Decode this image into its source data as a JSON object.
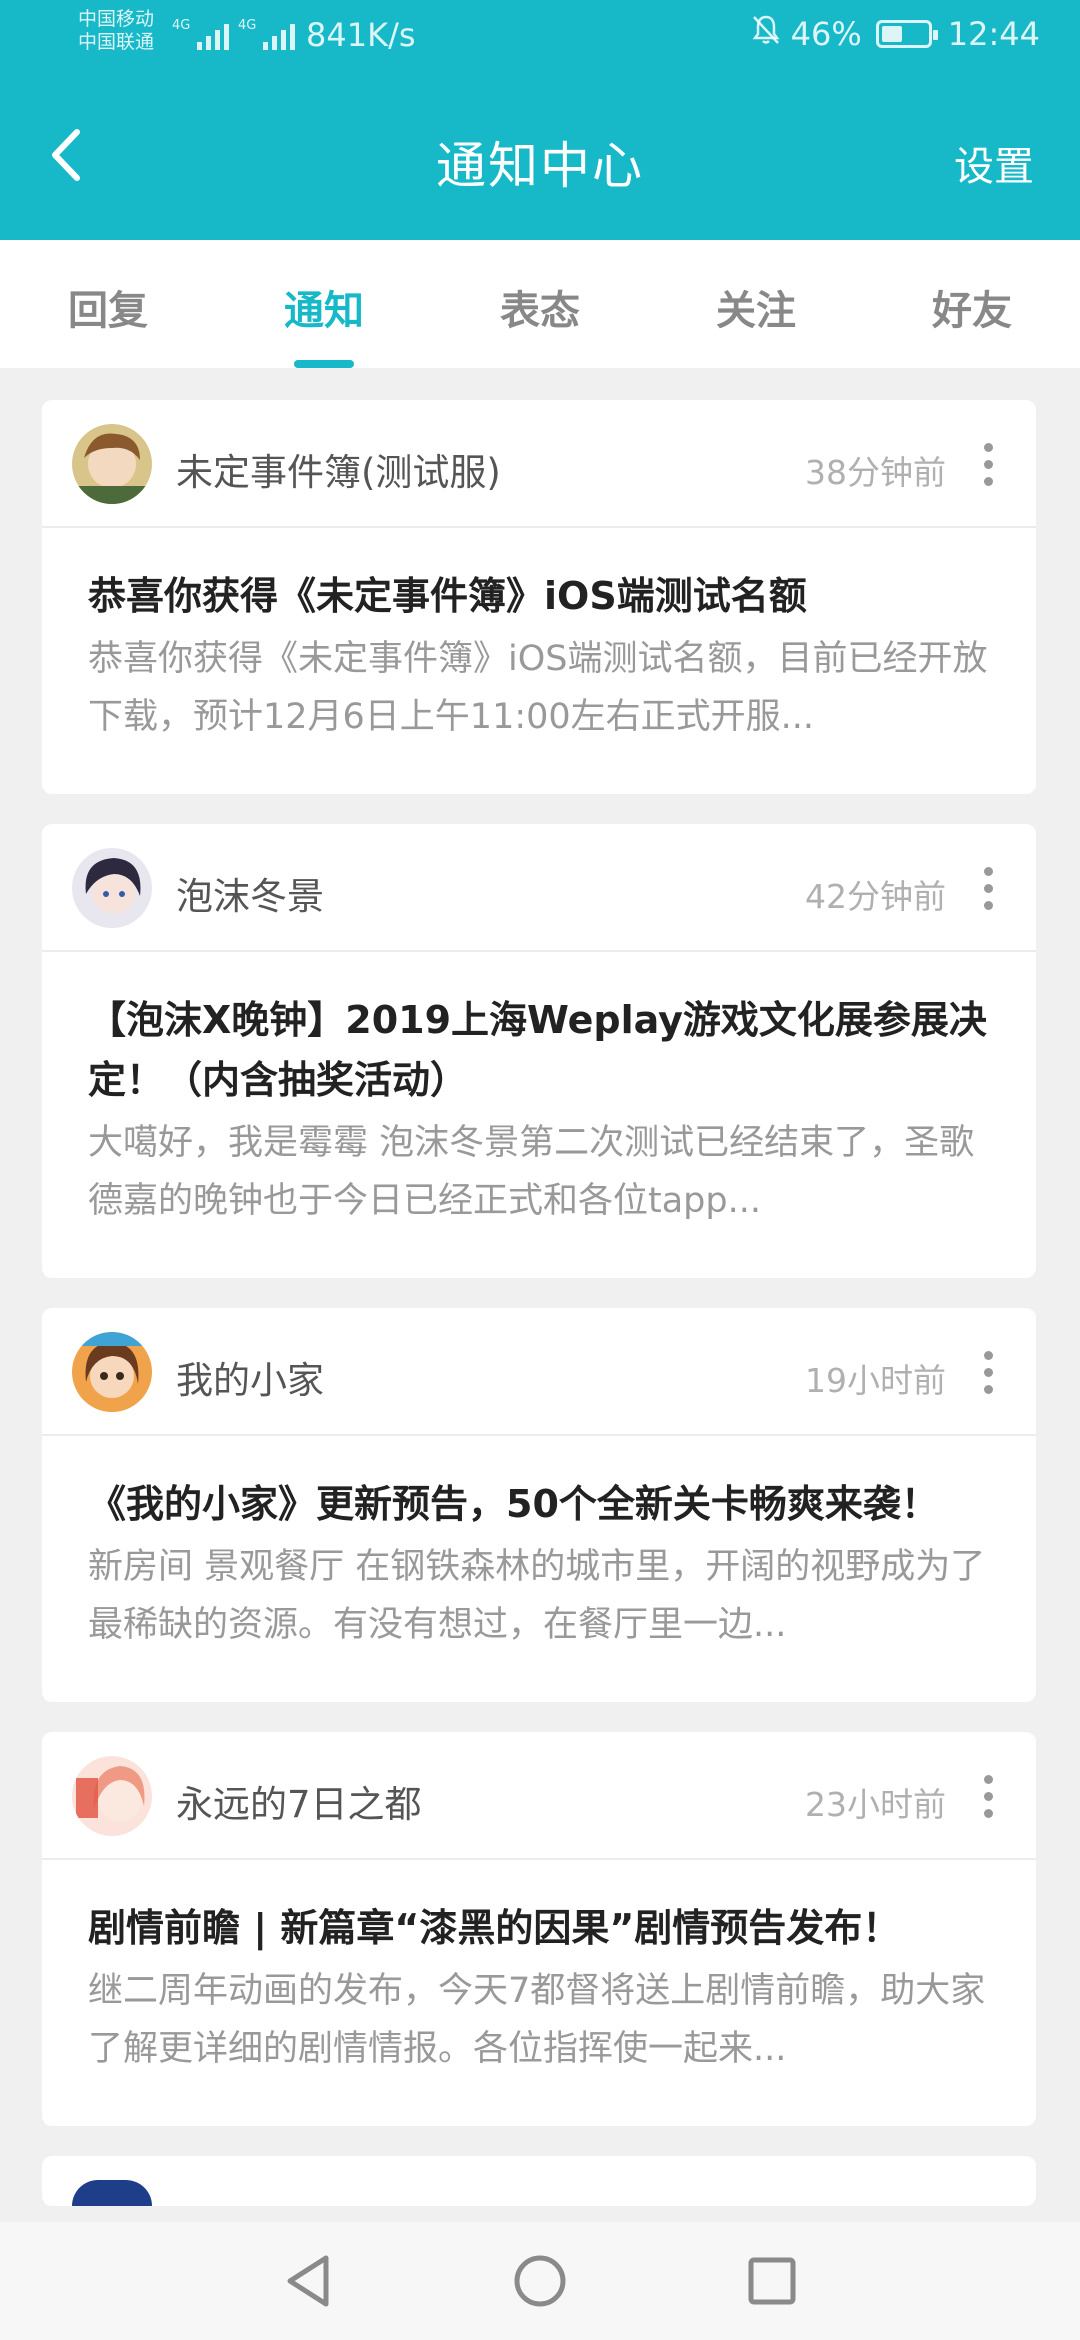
{
  "status_bar": {
    "carrier_1": "中国移动",
    "carrier_2": "中国联通",
    "signal_1_label": "4G",
    "signal_2_label": "4G",
    "net_speed": "841K/s",
    "battery_percent": "46%",
    "battery_level": 0.46,
    "time": "12:44",
    "icons": [
      "mute-bell-icon",
      "battery-icon"
    ]
  },
  "appbar": {
    "title": "通知中心",
    "settings_label": "设置",
    "back_icon": "chevron-left-icon",
    "color": "#17b9c9"
  },
  "tabs": [
    {
      "label": "回复",
      "active": false
    },
    {
      "label": "通知",
      "active": true
    },
    {
      "label": "表态",
      "active": false
    },
    {
      "label": "关注",
      "active": false
    },
    {
      "label": "好友",
      "active": false
    }
  ],
  "notifications": [
    {
      "source": "未定事件簿(测试服)",
      "time": "38分钟前",
      "title": "恭喜你获得《未定事件簿》iOS端测试名额",
      "desc": "恭喜你获得《未定事件簿》iOS端测试名额，目前已经开放下载，预计12月6日上午11:00左右正式开服..."
    },
    {
      "source": "泡沫冬景",
      "time": "42分钟前",
      "title": "【泡沫X晚钟】2019上海Weplay游戏文化展参展决定！（内含抽奖活动）",
      "desc": "大噶好，我是霉霉 泡沫冬景第二次测试已经结束了，圣歌德嘉的晚钟也于今日已经正式和各位tapp..."
    },
    {
      "source": "我的小家",
      "time": "19小时前",
      "title": "《我的小家》更新预告，50个全新关卡畅爽来袭！",
      "desc": "新房间 景观餐厅 在钢铁森林的城市里，开阔的视野成为了最稀缺的资源。有没有想过，在餐厅里一边..."
    },
    {
      "source": "永远的7日之都",
      "time": "23小时前",
      "title": "剧情前瞻 | 新篇章“漆黑的因果”剧情预告发布！",
      "desc": "继二周年动画的发布，今天7都督将送上剧情前瞻，助大家了解更详细的剧情情报。各位指挥使一起来..."
    }
  ],
  "navbar": {
    "icons": [
      "back-triangle-icon",
      "home-circle-icon",
      "recents-square-icon"
    ]
  }
}
